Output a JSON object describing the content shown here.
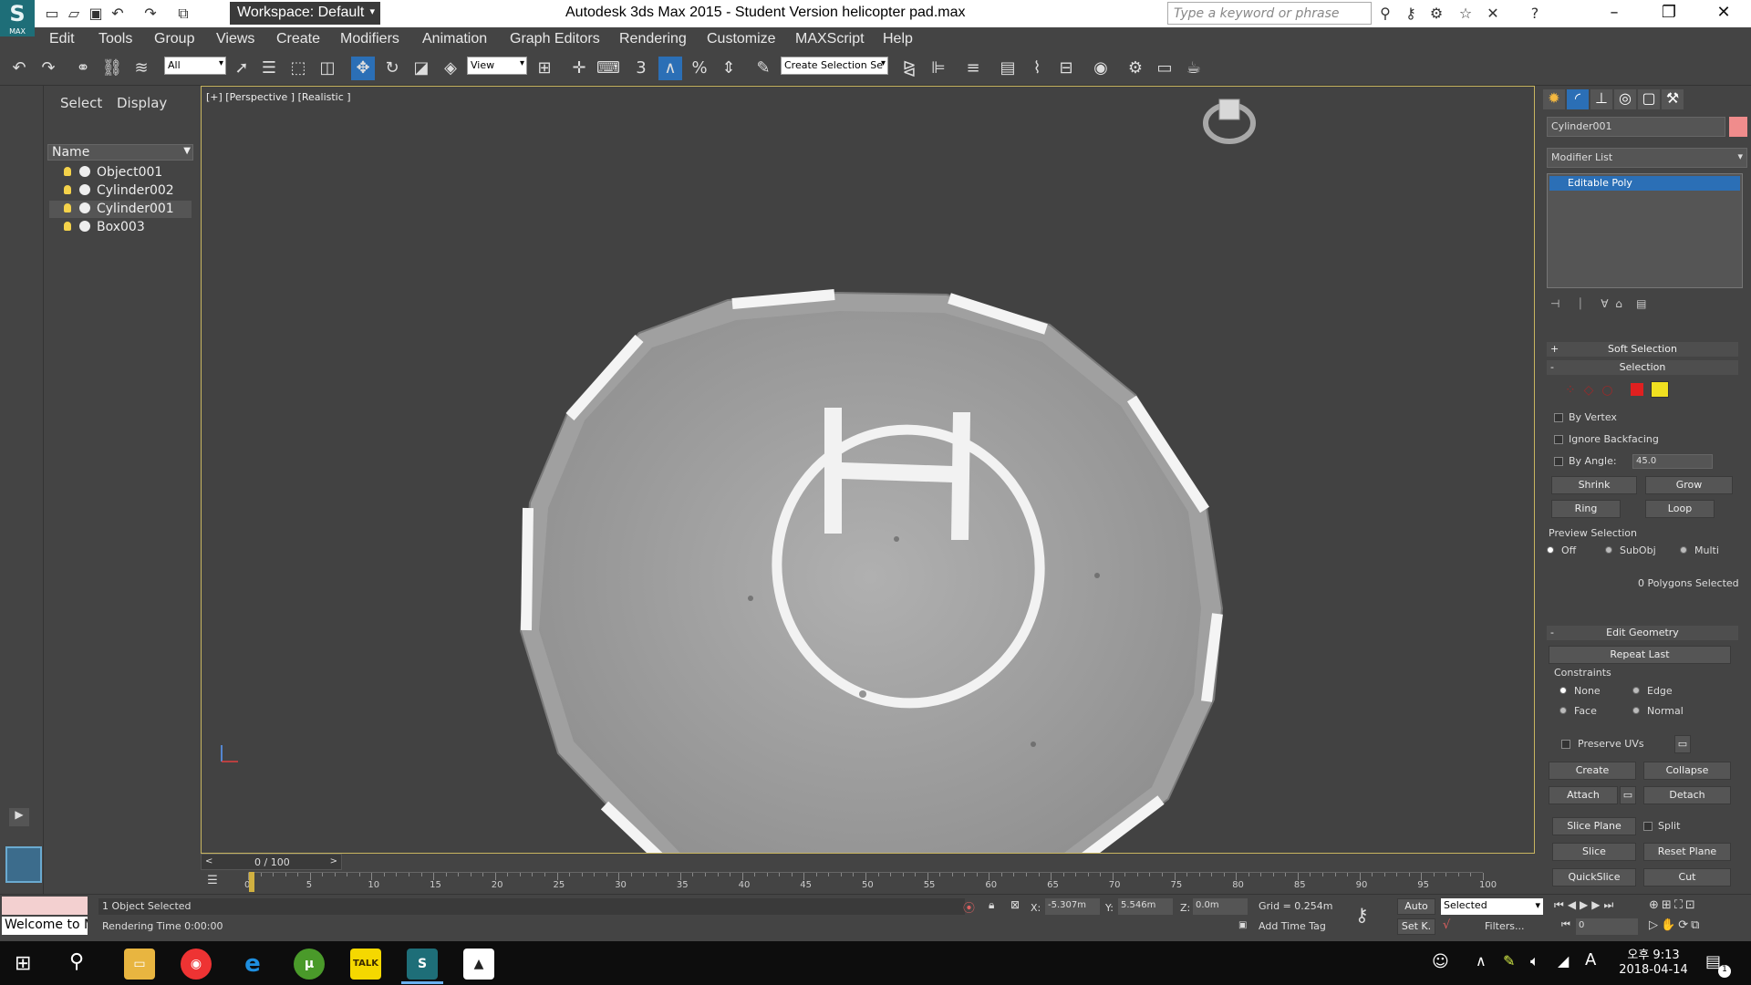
{
  "title_bar": {
    "app_title": "Autodesk 3ds Max  2015   - Student Version      helicopter pad.max",
    "workspace": "Workspace: Default",
    "search_placeholder": "Type a keyword or phrase",
    "logo_text": "MAX"
  },
  "menu": [
    "Edit",
    "Tools",
    "Group",
    "Views",
    "Create",
    "Modifiers",
    "Animation",
    "Graph Editors",
    "Rendering",
    "Customize",
    "MAXScript",
    "Help"
  ],
  "toolbar": {
    "filter": "All",
    "ref_coord": "View",
    "snap_label": "3",
    "selection_set": "Create Selection Se"
  },
  "explorer": {
    "tabs": [
      "Select",
      "Display"
    ],
    "column_header": "Name",
    "objects": [
      "Object001",
      "Cylinder002",
      "Cylinder001",
      "Box003"
    ],
    "selected": "Cylinder001"
  },
  "viewport": {
    "label": "[+] [Perspective ] [Realistic ]"
  },
  "command_panel": {
    "object_name": "Cylinder001",
    "modifier_list": "Modifier List",
    "stack_item": "Editable Poly",
    "soft_selection": "Soft Selection",
    "selection": "Selection",
    "by_vertex": "By Vertex",
    "ignore_backfacing": "Ignore Backfacing",
    "by_angle": "By Angle:",
    "angle_value": "45.0",
    "shrink": "Shrink",
    "grow": "Grow",
    "ring": "Ring",
    "loop": "Loop",
    "preview_selection": "Preview Selection",
    "preview_off": "Off",
    "preview_subobj": "SubObj",
    "preview_multi": "Multi",
    "polys_selected": "0 Polygons Selected",
    "edit_geometry": "Edit Geometry",
    "repeat_last": "Repeat Last",
    "constraints": "Constraints",
    "c_none": "None",
    "c_edge": "Edge",
    "c_face": "Face",
    "c_normal": "Normal",
    "preserve_uvs": "Preserve UVs",
    "create": "Create",
    "collapse": "Collapse",
    "attach": "Attach",
    "detach": "Detach",
    "slice_plane": "Slice Plane",
    "split": "Split",
    "slice": "Slice",
    "reset_plane": "Reset Plane",
    "quickslice": "QuickSlice",
    "cut": "Cut"
  },
  "timeline": {
    "frame": "0 / 100",
    "ticks": [
      "0",
      "5",
      "10",
      "15",
      "20",
      "25",
      "30",
      "35",
      "40",
      "45",
      "50",
      "55",
      "60",
      "65",
      "70",
      "75",
      "80",
      "85",
      "90",
      "95",
      "100"
    ]
  },
  "status": {
    "selected": "1 Object Selected",
    "render_time": "Rendering Time  0:00:00",
    "welcome": "Welcome to M",
    "x_label": "X:",
    "x": "-5.307m",
    "y_label": "Y:",
    "y": "5.546m",
    "z_label": "Z:",
    "z": "0.0m",
    "grid": "Grid = 0.254m",
    "add_time_tag": "Add Time Tag",
    "auto": "Auto",
    "set_key": "Set K.",
    "key_mode": "Selected",
    "filters": "Filters...",
    "frame_field": "0"
  },
  "taskbar": {
    "time": "오후 9:13",
    "date": "2018-04-14",
    "ime": "A",
    "notification_count": "1"
  },
  "colors": {
    "accent": "#2b6fb6",
    "viewport_border": "#c8b560",
    "swatch": "#f08c8c"
  }
}
